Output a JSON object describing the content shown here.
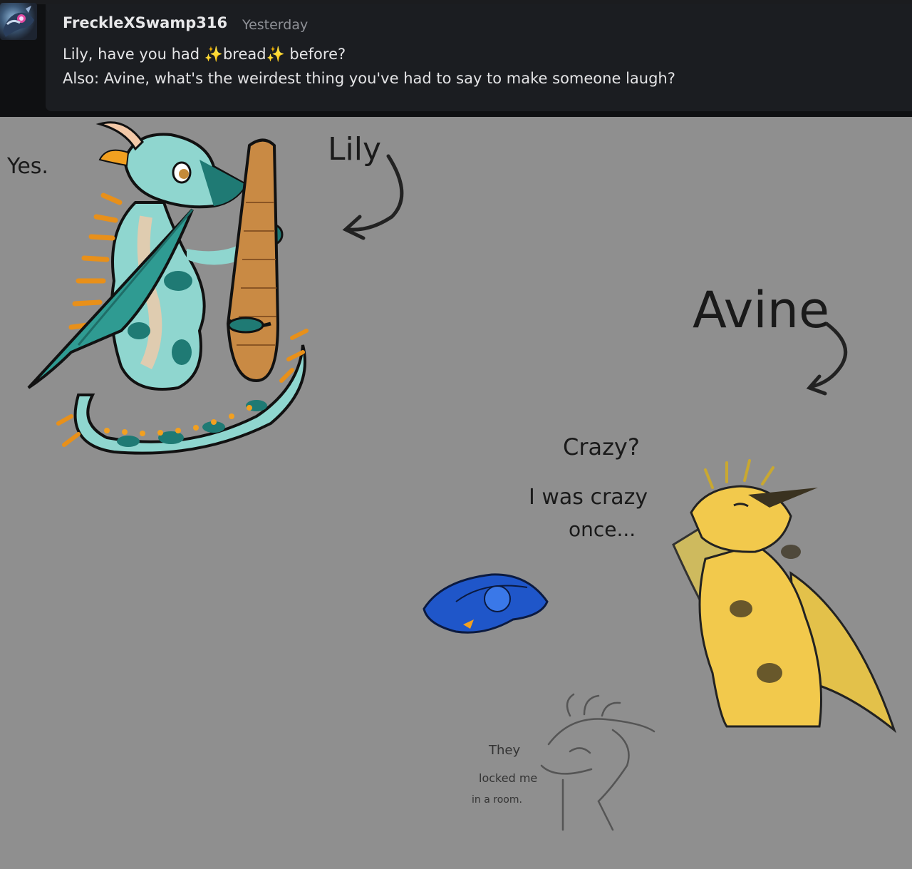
{
  "message": {
    "username": "FreckleXSwamp316",
    "timestamp": "Yesterday",
    "line1_a": "Lily, have you had ",
    "sparkle": "✨",
    "line1_b": "bread",
    "line1_c": " before?",
    "line2": "Also: Avine, what's the weirdest thing you've had to say to make someone laugh?"
  },
  "drawing": {
    "yes": "Yes.",
    "lily": "Lily",
    "avine": "Avine",
    "crazy_line1": "Crazy?",
    "crazy_line2": "I was crazy",
    "crazy_line3": "once...",
    "locked_line1": "They",
    "locked_line2": "locked me",
    "locked_line3": "in a room."
  },
  "colors": {
    "background": "#8f8f8f",
    "header": "#0f1012",
    "panel": "#1b1d21",
    "lily_body": "#8fd6cf",
    "lily_dark": "#1f7a74",
    "lily_accent": "#f2a020",
    "bread": "#c98a44",
    "avine_body": "#f2c94c",
    "blue_dragon": "#1f56c9"
  },
  "icons": {
    "avatar": "user-avatar",
    "sparkle": "sparkle-icon"
  }
}
